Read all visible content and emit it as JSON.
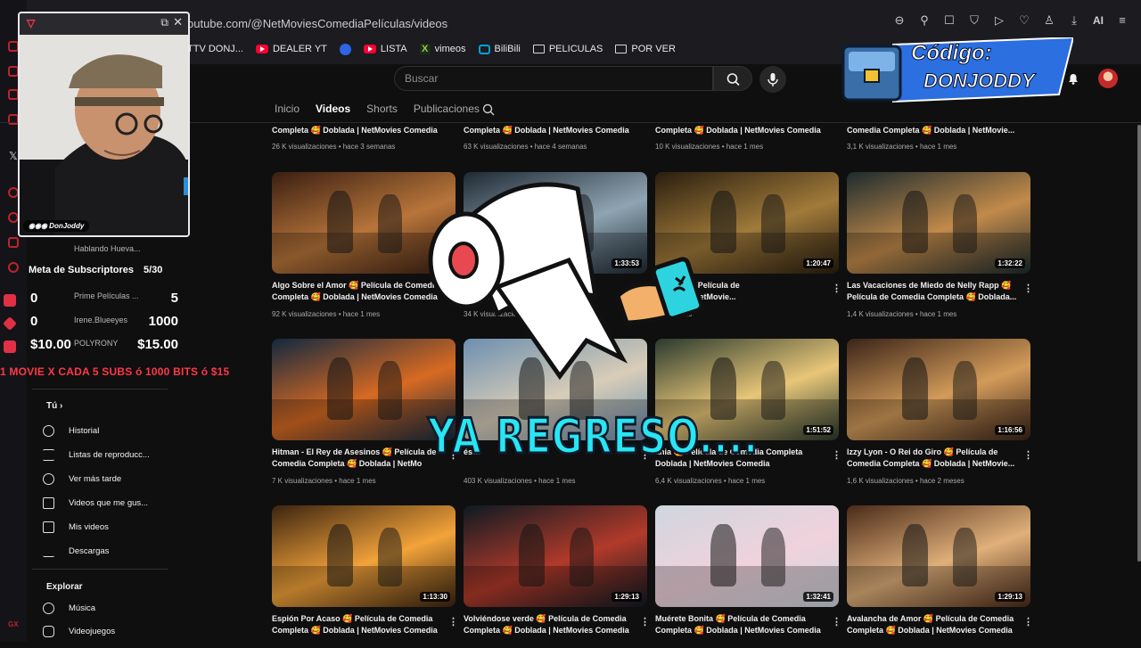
{
  "browser": {
    "url": "outube.com/@NetMoviesComediaPelículas/videos",
    "action_ai_label": "AI",
    "bookmarks": [
      {
        "label": "TTV DONJ...",
        "icon": "twitch-icon"
      },
      {
        "label": "DEALER YT",
        "icon": "youtube-icon"
      },
      {
        "label": "",
        "icon": "blue-circle-icon"
      },
      {
        "label": "LISTA",
        "icon": "youtube-icon"
      },
      {
        "label": "vimeos",
        "icon": "vimeo-icon"
      },
      {
        "label": "BiliBili",
        "icon": "bilibili-icon"
      },
      {
        "label": "PELICULAS",
        "icon": "folder-icon"
      },
      {
        "label": "POR VER",
        "icon": "folder-icon"
      }
    ]
  },
  "header": {
    "search_placeholder": "Buscar"
  },
  "tabs": [
    {
      "label": "Inicio",
      "active": false
    },
    {
      "label": "Videos",
      "active": true
    },
    {
      "label": "Shorts",
      "active": false
    },
    {
      "label": "Publicaciones",
      "active": false
    }
  ],
  "top_row": [
    {
      "title": "Completa 🥰 Doblada | NetMovies Comedia",
      "meta": "26 K visualizaciones • hace 3 semanas"
    },
    {
      "title": "Completa 🥰 Doblada | NetMovies Comedia",
      "meta": "63 K visualizaciones • hace 4 semanas"
    },
    {
      "title": "Completa 🥰 Doblada | NetMovies Comedia",
      "meta": "10 K visualizaciones • hace 1 mes"
    },
    {
      "title": "Comedia Completa 🥰 Doblada | NetMovie...",
      "meta": "3,1 K visualizaciones • hace 1 mes"
    }
  ],
  "videos": [
    {
      "title1": "Algo Sobre el Amor 🥰 Película de Comedia",
      "title2": "Completa 🥰 Doblada | NetMovies Comedia",
      "meta": "92 K visualizaciones • hace 1 mes",
      "duration": "1:",
      "colors": [
        "#3a1f12",
        "#b8753a"
      ]
    },
    {
      "title1": "🥰 Película de",
      "title2": "edia Com... | NetMovies",
      "meta": "34 K visualizaciones • hace 1 mes",
      "duration": "1:33:53",
      "colors": [
        "#1e2a33",
        "#8fa4b2"
      ]
    },
    {
      "title1": "n Perro 🥰 Película de",
      "title2": "Doblada | NetMovie...",
      "meta": "hace 1 mes",
      "duration": "1:20:47",
      "colors": [
        "#2a1e0f",
        "#a07a3a"
      ]
    },
    {
      "title1": "Las Vacaciones de Miedo de Nelly Rapp 🥰",
      "title2": "Película de Comedia Completa 🥰 Doblada...",
      "meta": "1,4 K visualizaciones • hace 1 mes",
      "duration": "1:32:22",
      "colors": [
        "#1c2b2e",
        "#c28a4a"
      ]
    },
    {
      "title1": "Hitman - El Rey de Asesinos 🥰 Película de",
      "title2": "Comedia Completa 🥰 Doblada | NetMo",
      "meta": "7 K visualizaciones • hace 1 mes",
      "duration": "",
      "colors": [
        "#12283f",
        "#d86a22"
      ]
    },
    {
      "title1": "ésta",
      "title2": "",
      "meta": "403 K visualizaciones • hace 1 mes",
      "duration": "",
      "colors": [
        "#6c8fb0",
        "#d8cdb8"
      ]
    },
    {
      "title1": "ánia 🥰 Película de Comedia Completa",
      "title2": "Doblada | NetMovies Comedia",
      "meta": "6,4 K visualizaciones • hace 1 mes",
      "duration": "1:51:52",
      "colors": [
        "#2a3a2e",
        "#e8c678"
      ]
    },
    {
      "title1": "Izzy Lyon - O Rei do Giro 🥰 Película de",
      "title2": "Comedia Completa 🥰 Doblada | NetMovie...",
      "meta": "1,6 K visualizaciones • hace 2 meses",
      "duration": "1:16:56",
      "colors": [
        "#3a2418",
        "#d39b5a"
      ]
    },
    {
      "title1": "Espión Por Acaso 🥰 Película de Comedia",
      "title2": "Completa 🥰 Doblada | NetMovies Comedia",
      "meta": "",
      "duration": "1:13:30",
      "colors": [
        "#3b2410",
        "#f3a33a"
      ]
    },
    {
      "title1": "Volviéndose verde 🥰 Película de Comedia",
      "title2": "Completa 🥰 Doblada | NetMovies Comedia",
      "meta": "",
      "duration": "1:29:13",
      "colors": [
        "#0d1a22",
        "#b23a2a"
      ]
    },
    {
      "title1": "Muérete Bonita 🥰 Película de Comedia",
      "title2": "Completa 🥰 Doblada | NetMovies Comedia",
      "meta": "",
      "duration": "1:32:41",
      "colors": [
        "#cfd6de",
        "#f0d2dc"
      ]
    },
    {
      "title1": "Avalancha de Amor 🥰 Película de Comedia",
      "title2": "Completa 🥰 Doblada | NetMovies Comedia",
      "meta": "",
      "duration": "1:29:13",
      "colors": [
        "#4a2a18",
        "#e0b07a"
      ]
    }
  ],
  "sidebar": {
    "you_label": "Tú",
    "items": [
      {
        "label": "Historial",
        "icon": "history-icon"
      },
      {
        "label": "Listas de reproducc...",
        "icon": "playlist-icon"
      },
      {
        "label": "Ver más tarde",
        "icon": "clock-icon"
      },
      {
        "label": "Videos que me gus...",
        "icon": "thumbs-up-icon"
      },
      {
        "label": "Mis videos",
        "icon": "my-videos-icon"
      },
      {
        "label": "Descargas",
        "icon": "download-icon"
      }
    ],
    "explore_label": "Explorar",
    "explore_items": [
      {
        "label": "Música",
        "icon": "music-icon"
      },
      {
        "label": "Videojuegos",
        "icon": "gamepad-icon"
      }
    ]
  },
  "stream": {
    "cam_name": "DonJoddy",
    "goal_label": "Meta de Subscriptores",
    "goal_value": "5/30",
    "rows": [
      {
        "left": "0",
        "right": "5",
        "icon": "gift-icon"
      },
      {
        "left": "0",
        "right": "1000",
        "icon": "bits-icon"
      },
      {
        "left": "$10.00",
        "right": "$15.00",
        "icon": "paypal-icon"
      }
    ],
    "goal_text": "1 MOVIE X CADA 5 SUBS ó 1000 BITS ó $15",
    "chat_lines": [
      "Hablando Hueva...",
      "Prime Películas ...",
      "Irene.Blueeyes",
      "POLYRONY"
    ],
    "code_line1": "Código:",
    "code_line2": "DONJODDY",
    "brb": "YA REGRESO...."
  }
}
